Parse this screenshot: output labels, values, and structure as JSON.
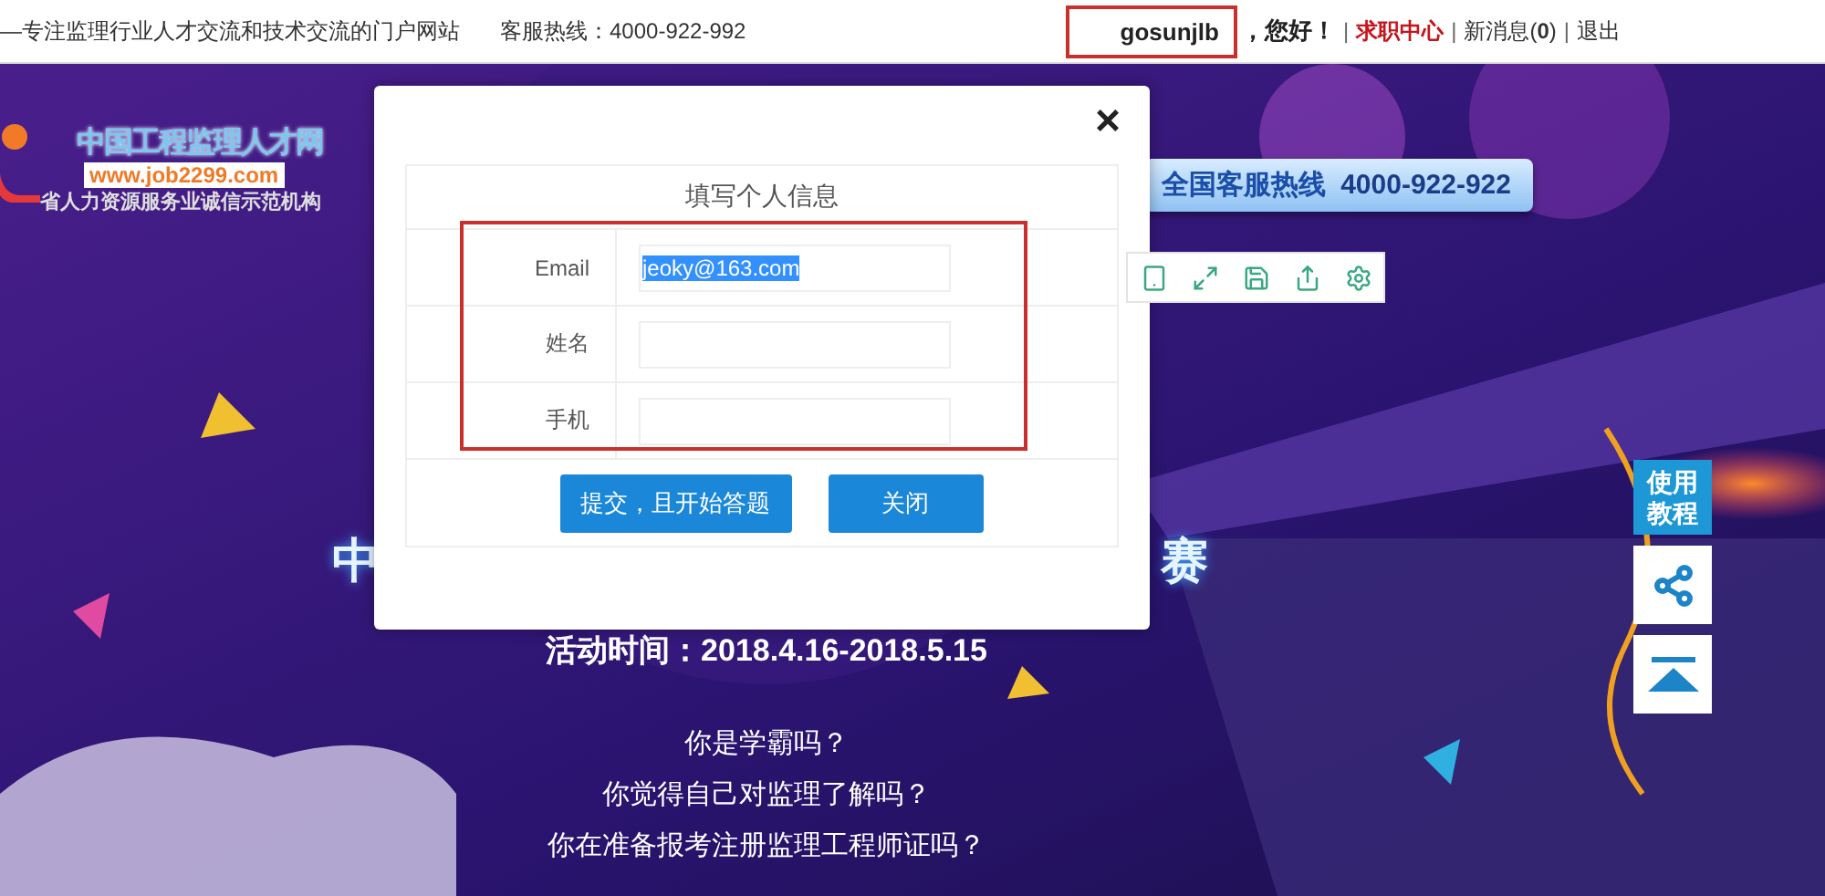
{
  "top_bar": {
    "tagline": "—专注监理行业人才交流和技术交流的门户网站",
    "hotline": "客服热线：4000-922-992",
    "user": {
      "name": "gosunjlb",
      "annotated": true
    },
    "items": [
      {
        "kind": "text",
        "text": "**，您好！**"
      },
      {
        "kind": "sep",
        "text": "|"
      },
      {
        "kind": "link",
        "text": "**求职中心**",
        "emphasis": true
      },
      {
        "kind": "sep",
        "text": "|"
      },
      {
        "kind": "link",
        "text": "新消息(**0**)",
        "emphasis": false
      },
      {
        "kind": "sep",
        "text": "|"
      },
      {
        "kind": "link",
        "text": "退出",
        "emphasis": false
      }
    ]
  },
  "banner": {
    "logo": {
      "title": "中国工程监理人才网",
      "url": "www.job2299.com",
      "slogan": "省人力资源服务业诚信示范机构"
    },
    "hotline": {
      "label": "全国客服热线",
      "number": "4000-922-922"
    },
    "headline_left": "中",
    "headline_right": "赛",
    "activity_time": "活动时间：2018.4.16-2018.5.15",
    "questions": [
      "你是学霸吗？",
      "你觉得自己对监理了解吗？",
      "你在准备报考注册监理工程师证吗？"
    ]
  },
  "side_widgets": {
    "tutorial": "使用教程"
  },
  "modal": {
    "close": "×",
    "title": "填写个人信息",
    "annotated": true,
    "fields": [
      {
        "label": "Email",
        "value": "jeoky@163.com",
        "highlighted": true
      },
      {
        "label": "姓名"
      },
      {
        "label": "手机"
      }
    ],
    "buttons": [
      "提交，且开始答题",
      "关闭"
    ]
  }
}
